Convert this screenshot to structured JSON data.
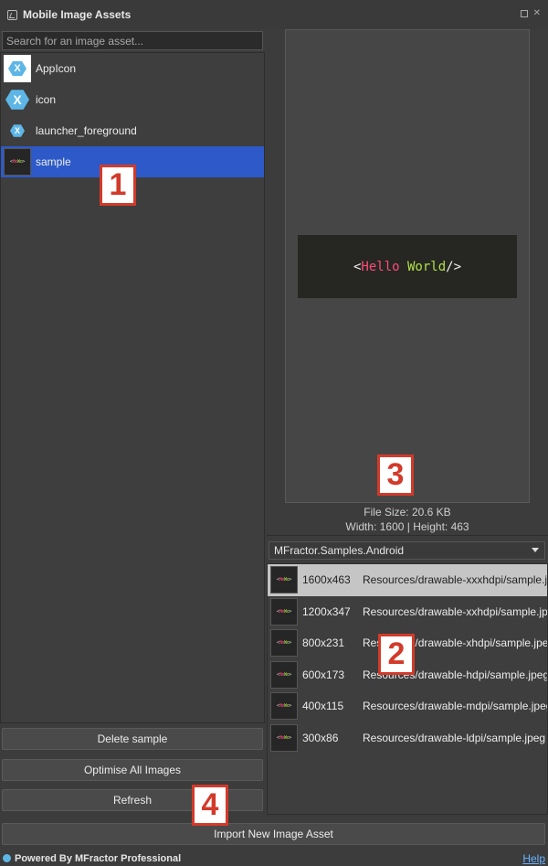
{
  "window": {
    "title": "Mobile Image Assets"
  },
  "search": {
    "placeholder": "Search for an image asset..."
  },
  "assets": [
    {
      "label": "AppIcon",
      "icon": "xamarin-hex-icon"
    },
    {
      "label": "icon",
      "icon": "xamarin-hex-icon"
    },
    {
      "label": "launcher_foreground",
      "icon": "xamarin-hex-icon"
    },
    {
      "label": "sample",
      "icon": "hello-world-thumbnail",
      "selected": true
    }
  ],
  "actions": {
    "delete": "Delete sample",
    "optimise": "Optimise All Images",
    "refresh": "Refresh",
    "import": "Import New Image Asset"
  },
  "preview": {
    "code_open": "<",
    "code_hello": "Hello",
    "code_world": "World",
    "code_close": "/>",
    "colors": {
      "bracket": "#f0f0f0",
      "hello": "#ff4b7a",
      "world": "#b0e04a",
      "background": "#262722"
    }
  },
  "file_info": {
    "size": "File Size: 20.6 KB",
    "dimensions": "Width: 1600 | Height: 463"
  },
  "project": {
    "selected": "MFractor.Samples.Android"
  },
  "densities": [
    {
      "dims": "1600x463",
      "path": "Resources/drawable-xxxhdpi/sample.jpeg",
      "selected": true
    },
    {
      "dims": "1200x347",
      "path": "Resources/drawable-xxhdpi/sample.jpeg"
    },
    {
      "dims": "800x231",
      "path": "Resources/drawable-xhdpi/sample.jpeg"
    },
    {
      "dims": "600x173",
      "path": "Resources/drawable-hdpi/sample.jpeg"
    },
    {
      "dims": "400x115",
      "path": "Resources/drawable-mdpi/sample.jpeg"
    },
    {
      "dims": "300x86",
      "path": "Resources/drawable-ldpi/sample.jpeg"
    }
  ],
  "footer": {
    "powered": "Powered By MFractor Professional",
    "help": "Help"
  },
  "callouts": [
    "1",
    "2",
    "3",
    "4"
  ],
  "colors": {
    "selection": "#2d5ac8",
    "callout_border": "#d23a2a",
    "link": "#6ab2ff"
  }
}
